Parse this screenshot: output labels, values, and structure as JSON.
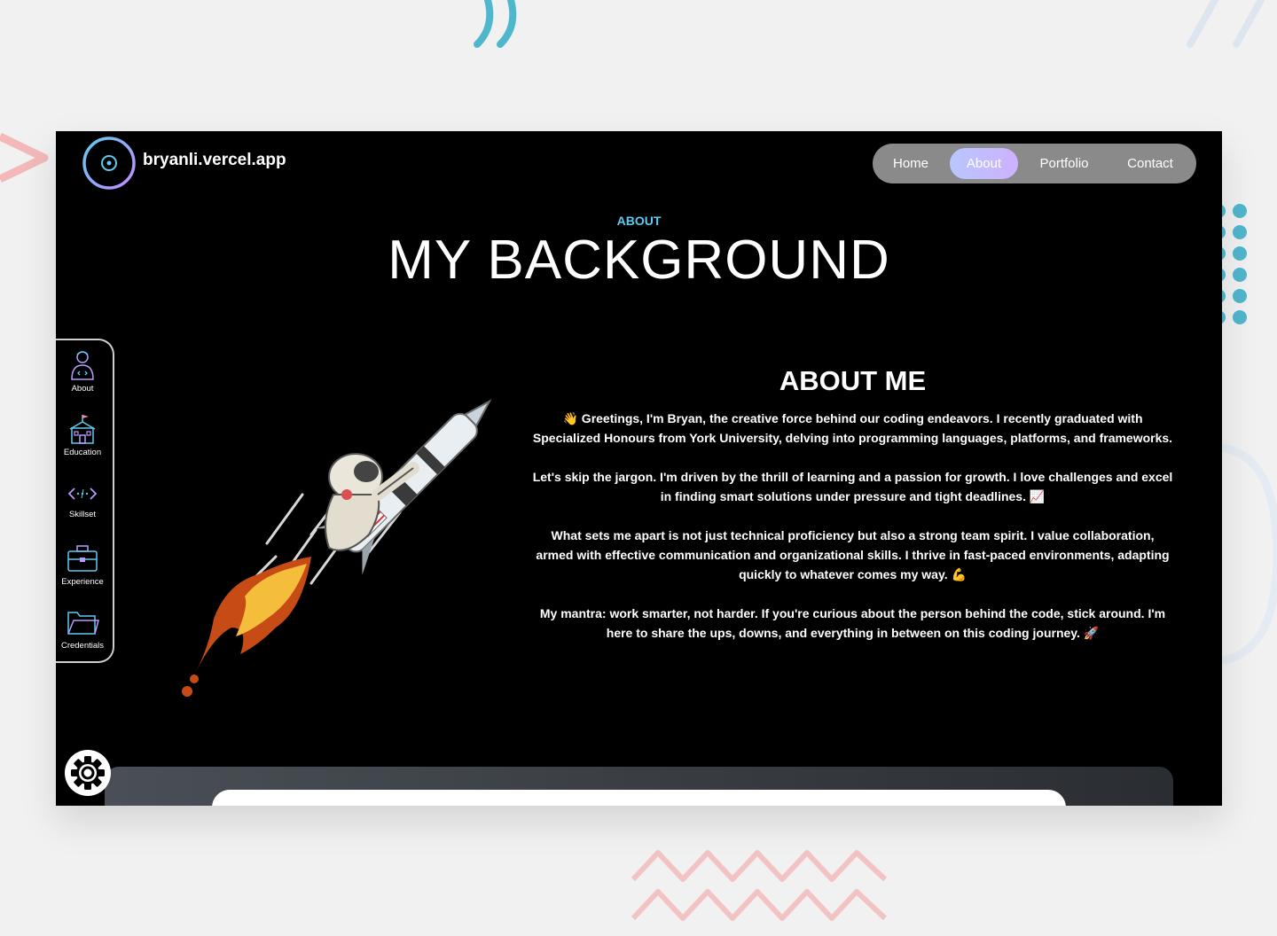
{
  "colors": {
    "accent_cyan": "#5ecbf0",
    "nav_active": "#c4bbff",
    "nav_bg": "#8a8a8a",
    "deco_pink": "#f3b9b9",
    "deco_teal": "#4fb7cc"
  },
  "header": {
    "brand": "bryanli.vercel.app",
    "logo_icon": "target-circle-icon",
    "nav": [
      {
        "label": "Home",
        "active": false
      },
      {
        "label": "About",
        "active": true
      },
      {
        "label": "Portfolio",
        "active": false
      },
      {
        "label": "Contact",
        "active": false
      }
    ]
  },
  "section": {
    "eyebrow": "ABOUT",
    "title": "MY BACKGROUND"
  },
  "side_nav": {
    "items": [
      {
        "label": "About",
        "icon": "developer-icon"
      },
      {
        "label": "Education",
        "icon": "school-icon"
      },
      {
        "label": "Skillset",
        "icon": "code-icon"
      },
      {
        "label": "Experience",
        "icon": "briefcase-icon"
      },
      {
        "label": "Credentials",
        "icon": "folder-icon"
      }
    ]
  },
  "about": {
    "heading": "ABOUT ME",
    "paragraphs": [
      "👋 Greetings, I'm Bryan, the creative force behind our coding endeavors. I recently graduated with Specialized Honours from York University, delving into programming languages, platforms, and frameworks.",
      "Let's skip the jargon. I'm driven by the thrill of learning and a passion for growth. I love challenges and excel in finding smart solutions under pressure and tight deadlines. 📈",
      "What sets me apart is not just technical proficiency but also a strong team spirit. I value collaboration, armed with effective communication and organizational skills. I thrive in fast-paced environments, adapting quickly to whatever comes my way. 💪",
      "My mantra: work smarter, not harder. If you're curious about the person behind the code, stick around. I'm here to share the ups, downs, and everything in between on this coding journey. 🚀"
    ]
  },
  "illustration": {
    "icon": "astronaut-rocket-illustration"
  },
  "settings": {
    "icon": "gear-icon"
  }
}
